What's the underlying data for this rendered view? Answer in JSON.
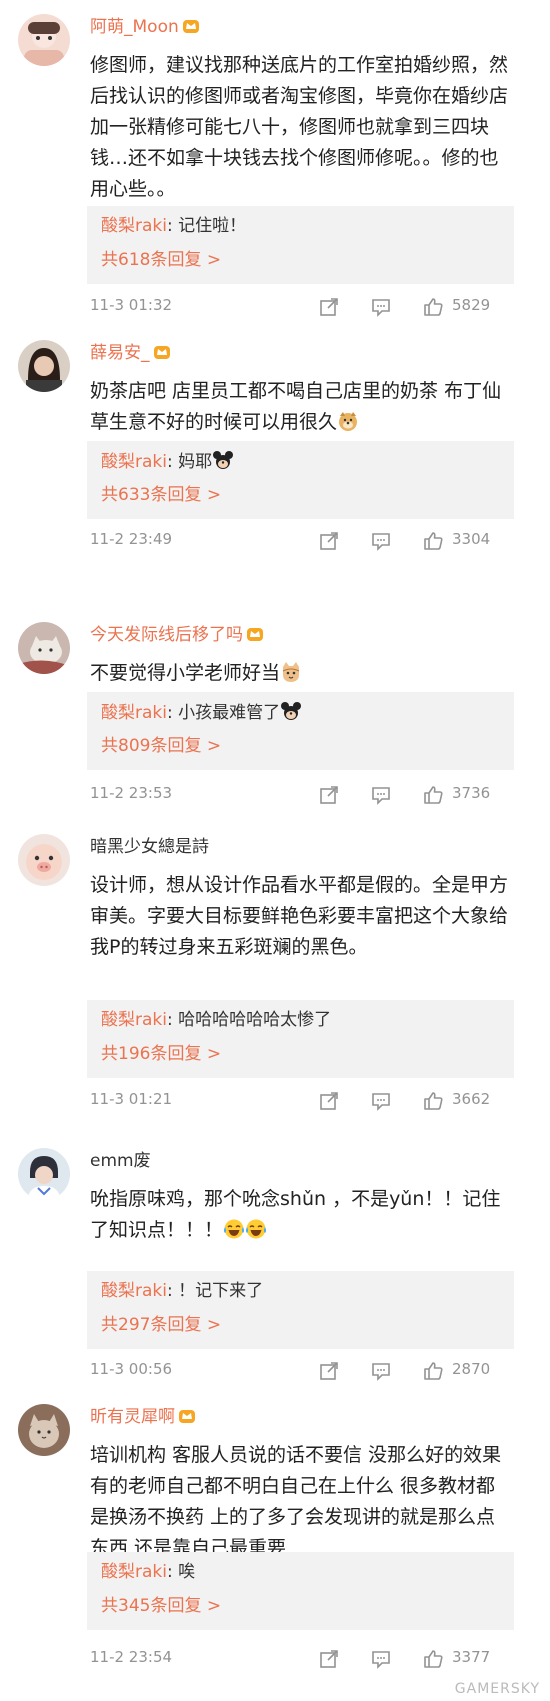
{
  "comments": [
    {
      "username": "阿萌_Moon",
      "text": "修图师，建议找那种送底片的工作室拍婚纱照，然后找认识的修图师或者淘宝修图，毕竟你在婚纱店加一张精修可能七八十，修图师也就拿到三四块钱…还不如拿十块钱去找个修图师修呢。。修的也用心些。。",
      "reply_user": "酸梨raki",
      "reply_text": "记住啦！",
      "reply_count": "共618条回复 >",
      "time": "11-3 01:32",
      "likes": "5829"
    },
    {
      "username": "薛易安_",
      "text": "奶茶店吧 店里员工都不喝自己店里的奶茶 布丁仙草生意不好的时候可以用很久",
      "reply_user": "酸梨raki",
      "reply_text": "妈耶",
      "reply_count": "共633条回复 >",
      "time": "11-2 23:49",
      "likes": "3304"
    },
    {
      "username": "今天发际线后移了吗",
      "text": "不要觉得小学老师好当",
      "reply_user": "酸梨raki",
      "reply_text": "小孩最难管了",
      "reply_count": "共809条回复 >",
      "time": "11-2 23:53",
      "likes": "3736"
    },
    {
      "username": "暗黑少女總是詩",
      "text": "设计师，想从设计作品看水平都是假的。全是甲方审美。字要大目标要鲜艳色彩要丰富把这个大象给我P的转过身来五彩斑斓的黑色。",
      "reply_user": "酸梨raki",
      "reply_text": "哈哈哈哈哈哈太惨了",
      "reply_count": "共196条回复 >",
      "time": "11-3 01:21",
      "likes": "3662"
    },
    {
      "username": "emm废",
      "text": "吮指原味鸡，那个吮念shǔn ，不是yǔn！！记住了知识点！！！",
      "reply_user": "酸梨raki",
      "reply_text": "！记下来了",
      "reply_count": "共297条回复 >",
      "time": "11-3 00:56",
      "likes": "2870"
    },
    {
      "username": "昕有灵犀啊",
      "text": "培训机构 客服人员说的话不要信 没那么好的效果 有的老师自己都不明白自己在上什么 很多教材都是换汤不换药 上的了多了会发现讲的就是那么点东西 还是靠自己最重要",
      "reply_user": "酸梨raki",
      "reply_text": "唉",
      "reply_count": "共345条回复 >",
      "time": "11-2 23:54",
      "likes": "3377"
    }
  ],
  "watermark": "GAMERSKY",
  "colors": {
    "accent": "#eb7350",
    "meta": "#939393",
    "reply_bg": "#f2f2f2"
  }
}
